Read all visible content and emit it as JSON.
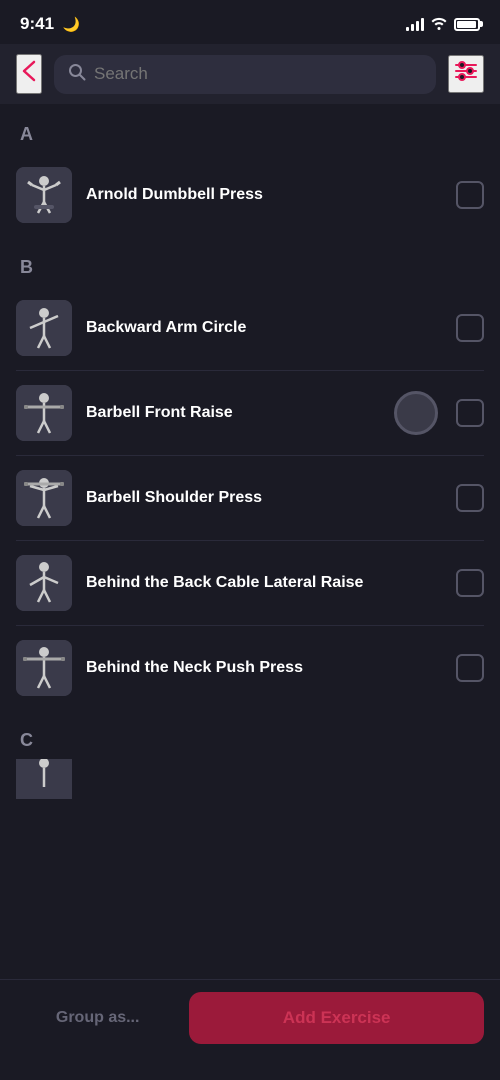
{
  "statusBar": {
    "time": "9:41",
    "moonIcon": "🌙"
  },
  "topBar": {
    "backIcon": "←",
    "searchPlaceholder": "Search",
    "filterIcon": "⚙"
  },
  "sections": [
    {
      "letter": "A",
      "exercises": [
        {
          "id": "arnold-dumbbell-press",
          "name": "Arnold Dumbbell Press",
          "checked": false,
          "hasCircle": false,
          "figureType": "dumbbell-press"
        }
      ]
    },
    {
      "letter": "B",
      "exercises": [
        {
          "id": "backward-arm-circle",
          "name": "Backward Arm Circle",
          "checked": false,
          "hasCircle": false,
          "figureType": "arm-circle"
        },
        {
          "id": "barbell-front-raise",
          "name": "Barbell Front Raise",
          "checked": false,
          "hasCircle": true,
          "figureType": "barbell-raise"
        },
        {
          "id": "barbell-shoulder-press",
          "name": "Barbell Shoulder Press",
          "checked": false,
          "hasCircle": false,
          "figureType": "shoulder-press"
        },
        {
          "id": "behind-back-cable",
          "name": "Behind the Back Cable Lateral Raise",
          "checked": false,
          "hasCircle": false,
          "figureType": "cable-raise"
        },
        {
          "id": "behind-neck-push",
          "name": "Behind the Neck Push Press",
          "checked": false,
          "hasCircle": false,
          "figureType": "neck-press"
        }
      ]
    },
    {
      "letter": "C",
      "exercises": []
    }
  ],
  "bottomBar": {
    "groupAsLabel": "Group as...",
    "addExerciseLabel": "Add Exercise"
  }
}
